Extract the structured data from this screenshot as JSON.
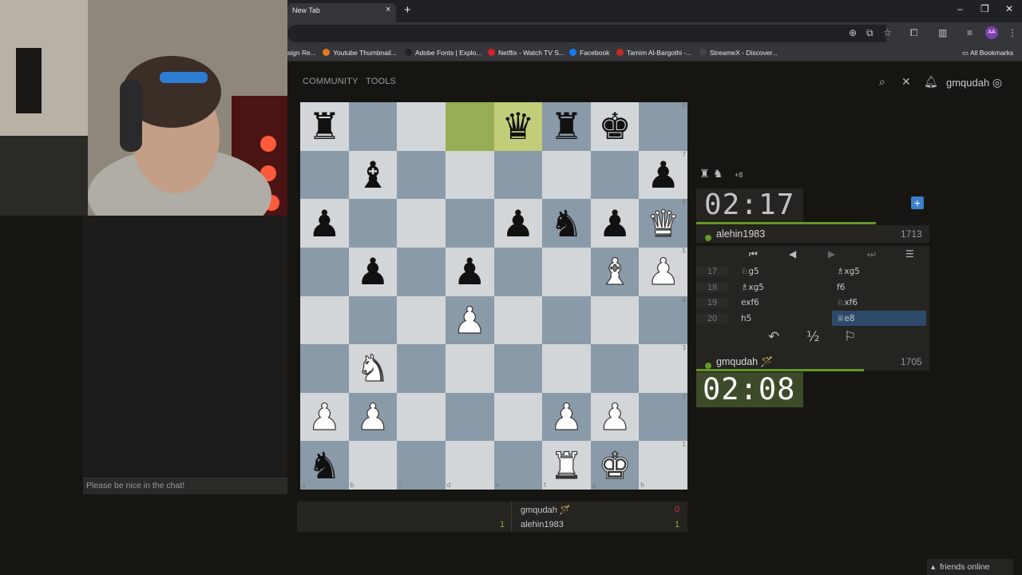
{
  "browser": {
    "tab_title": "New Tab",
    "tab_close": "×",
    "new_tab": "+",
    "window_controls": [
      "–",
      "❐",
      "✕"
    ],
    "bookmarks": [
      {
        "label": "sign Re...",
        "color": "#555555"
      },
      {
        "label": "Youtube Thumbnail...",
        "color": "#e07a1f"
      },
      {
        "label": "Adobe Fonts | Explo...",
        "color": "#222222"
      },
      {
        "label": "Netflix - Watch TV S...",
        "color": "#d81f26"
      },
      {
        "label": "Facebook",
        "color": "#1877f2"
      },
      {
        "label": "Tamim Al-Bargothi -...",
        "color": "#c62828"
      },
      {
        "label": "StreameX - Discover...",
        "color": "#444444"
      }
    ],
    "all_bookmarks": "All Bookmarks",
    "profile_initials": "AA"
  },
  "nav": {
    "community": "COMMUNITY",
    "tools": "TOOLS",
    "username": "gmqudah"
  },
  "chat": {
    "placeholder": "Please be nice in the chat!"
  },
  "board": {
    "ranks": [
      [
        "bR",
        "",
        "",
        "",
        "bQ",
        "bR",
        "bK",
        ""
      ],
      [
        "",
        "bB",
        "",
        "",
        "",
        "",
        "",
        "bP"
      ],
      [
        "bP",
        "",
        "",
        "",
        "bP",
        "bN",
        "bP",
        "wQ"
      ],
      [
        "",
        "bP",
        "",
        "bP",
        "",
        "",
        "wB",
        "wP"
      ],
      [
        "",
        "",
        "",
        "wP",
        "",
        "",
        "",
        ""
      ],
      [
        "",
        "wN",
        "",
        "",
        "",
        "",
        "",
        ""
      ],
      [
        "wP",
        "wP",
        "",
        "",
        "",
        "wP",
        "wP",
        ""
      ],
      [
        "bN",
        "",
        "",
        "",
        "",
        "wR",
        "wK",
        ""
      ]
    ],
    "highlight": [
      [
        0,
        3
      ],
      [
        0,
        4
      ]
    ],
    "files": [
      "a",
      "b",
      "c",
      "d",
      "e",
      "f",
      "g",
      "h"
    ],
    "rank_labels": [
      "8",
      "7",
      "6",
      "5",
      "4",
      "3",
      "2",
      "1"
    ]
  },
  "game": {
    "captured": "♜ ♞",
    "captured_plus": "+8",
    "top_clock": "02:17",
    "top_player": "alehin1983",
    "top_rating": "1713",
    "top_clock_fraction": 0.77,
    "bottom_clock": "02:08",
    "bottom_player": "gmqudah 🪄",
    "bottom_rating": "1705",
    "bottom_clock_fraction": 0.72,
    "moves": [
      {
        "num": "17",
        "white": "♘g5",
        "black": "♗xg5"
      },
      {
        "num": "18",
        "white": "♗xg5",
        "black": "f6"
      },
      {
        "num": "19",
        "white": "exf6",
        "black": "♘xf6"
      },
      {
        "num": "20",
        "white": "h5",
        "black": "♕e8"
      }
    ],
    "draw_label": "½"
  },
  "crosstable": {
    "row1_name": "gmqudah 🪄",
    "row1_score": "0",
    "row2_left": "1",
    "row2_name": "alehin1983",
    "row2_score": "1"
  },
  "footer": {
    "friends": "friends online"
  }
}
